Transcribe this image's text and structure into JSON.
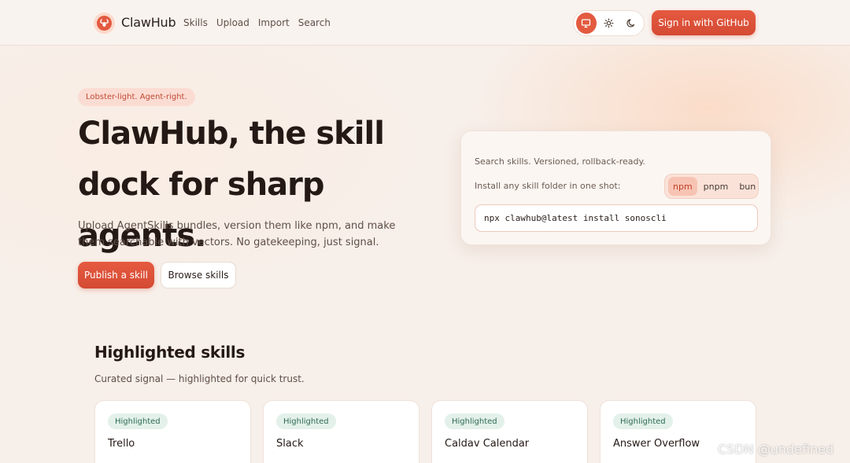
{
  "header": {
    "brand": "ClawHub",
    "nav": [
      "Skills",
      "Upload",
      "Import",
      "Search"
    ],
    "theme_modes": [
      "monitor-icon",
      "sun-icon",
      "moon-icon"
    ],
    "signin_label": "Sign in  with GitHub"
  },
  "hero": {
    "tagline": "Lobster-light. Agent-right.",
    "title": "ClawHub, the skill dock for sharp agents.",
    "subtitle": "Upload AgentSkills bundles, version them like npm, and make them searchable with vectors. No gatekeeping, just signal.",
    "primary_button": "Publish a skill",
    "secondary_button": "Browse skills"
  },
  "install_card": {
    "line1": "Search skills. Versioned, rollback-ready.",
    "line2": "Install any skill folder in one shot:",
    "package_managers": [
      "npm",
      "pnpm",
      "bun"
    ],
    "selected": "npm",
    "command": "npx clawhub@latest install sonoscli"
  },
  "highlighted": {
    "title": "Highlighted skills",
    "subtitle": "Curated signal — highlighted for quick trust.",
    "cards": [
      {
        "badge": "Highlighted",
        "title": "Trello",
        "desc": ""
      },
      {
        "badge": "Highlighted",
        "title": "Slack",
        "desc": ""
      },
      {
        "badge": "Highlighted",
        "title": "Caldav Calendar",
        "desc": ""
      },
      {
        "badge": "Highlighted",
        "title": "Answer Overflow",
        "desc": ""
      }
    ]
  },
  "watermark": "CSDN @undefined",
  "colors": {
    "accent": "#e35a3f",
    "background": "#f7efe9",
    "badge_bg": "#e3f1ea"
  }
}
